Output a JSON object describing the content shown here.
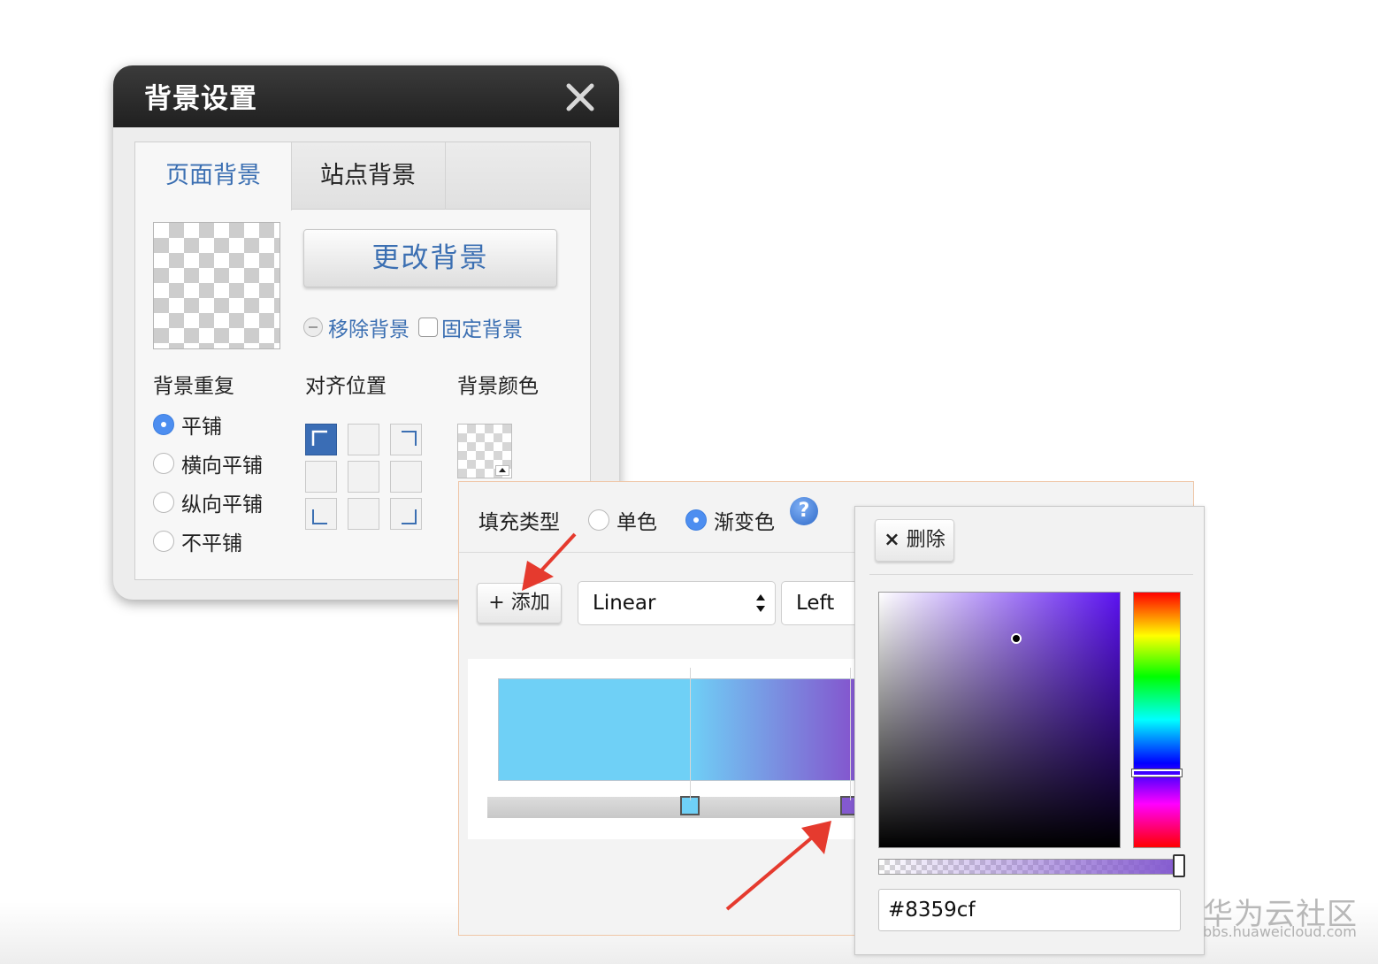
{
  "dialog": {
    "title": "背景设置",
    "tabs": [
      "页面背景",
      "站点背景"
    ],
    "change_bg_label": "更改背景",
    "remove_bg_label": "移除背景",
    "fixed_bg_label": "固定背景",
    "repeat": {
      "label": "背景重复",
      "options": [
        "平铺",
        "横向平铺",
        "纵向平铺",
        "不平铺"
      ],
      "selected": "平铺"
    },
    "align": {
      "label": "对齐位置",
      "selected": "top-left"
    },
    "bg_color": {
      "label": "背景颜色"
    }
  },
  "fill": {
    "type_label": "填充类型",
    "options": [
      "单色",
      "渐变色"
    ],
    "selected": "渐变色",
    "help_glyph": "?",
    "add_label": "添加",
    "add_glyph": "+",
    "gradient_type": "Linear",
    "direction": "Left",
    "stops": [
      {
        "color": "#6fd0f6",
        "position": 0.53
      },
      {
        "color": "#8359cf",
        "position": 0.97
      }
    ]
  },
  "picker": {
    "delete_label": "删除",
    "delete_glyph": "×",
    "hex_value": "#8359cf",
    "saturation": 0.57,
    "brightness": 0.82,
    "hue_fraction": 0.71,
    "alpha": 1.0
  },
  "watermark": {
    "cn": "华为云社区",
    "en": "bbs.huaweicloud.com"
  },
  "colors": {
    "accent_blue": "#3b6fb2",
    "radio_blue": "#4d8ef0",
    "arrow_red": "#e53a2e",
    "popup_border": "#efc6a7"
  }
}
